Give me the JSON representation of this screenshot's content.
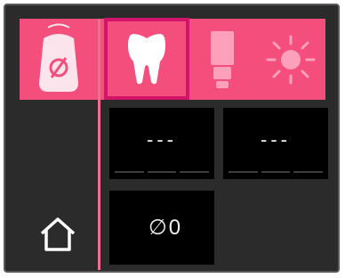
{
  "colors": {
    "accent": "#f44e7d",
    "selected_border": "#d2146b",
    "panel_bg": "#000000",
    "device_bg": "#2b2b2b"
  },
  "sidebar": {
    "status_icon": "aligner-case-empty-icon",
    "home_icon": "home-icon"
  },
  "tabs": [
    {
      "icon": "tooth-icon",
      "selected": true
    },
    {
      "icon": "toothpaste-tube-icon",
      "selected": false
    },
    {
      "icon": "sun-icon",
      "selected": false
    }
  ],
  "panels": {
    "left_value": "---",
    "right_value": "---",
    "diameter_symbol": "∅",
    "diameter_value": "0"
  }
}
